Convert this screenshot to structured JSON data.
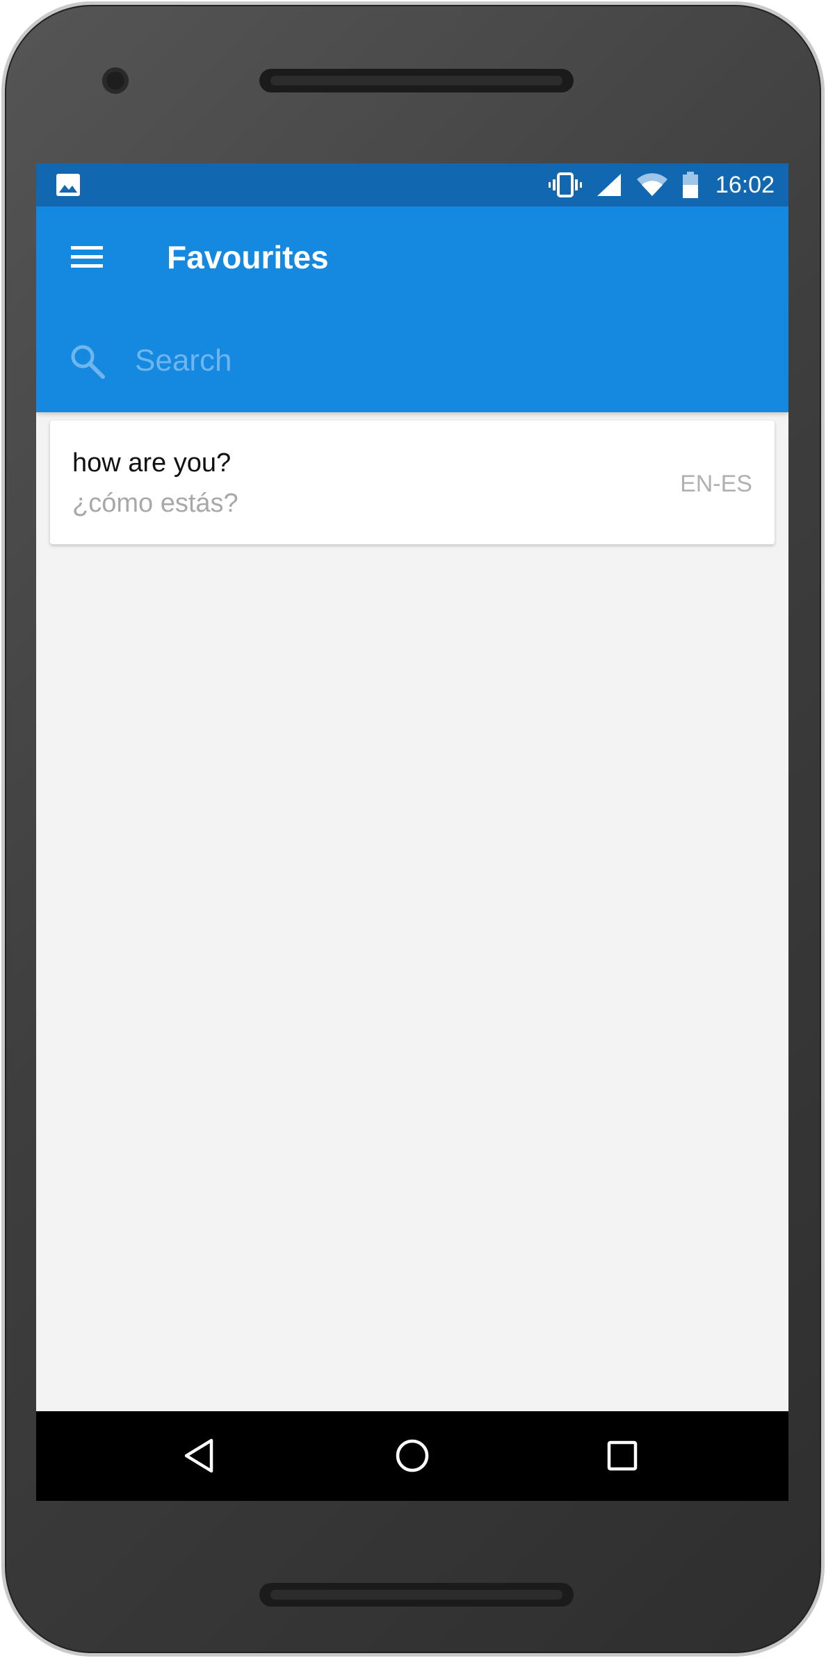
{
  "status_bar": {
    "left_icon": "image-notification-icon",
    "icons": [
      "vibrate-icon",
      "cell-signal-icon",
      "wifi-icon",
      "battery-icon"
    ],
    "time": "16:02"
  },
  "app_bar": {
    "menu_icon": "hamburger-menu-icon",
    "title": "Favourites",
    "search": {
      "icon": "search-icon",
      "placeholder": "Search",
      "value": ""
    }
  },
  "favourites": [
    {
      "source": "how are you?",
      "translation": "¿cómo estás?",
      "language_pair": "EN-ES"
    }
  ],
  "nav_bar": {
    "buttons": [
      "back-icon",
      "home-icon",
      "recents-icon"
    ]
  },
  "colors": {
    "status_bar": "#1268b0",
    "app_bar": "#1589e0",
    "background": "#f3f3f3",
    "card": "#ffffff",
    "secondary_text": "#a8a8a8"
  }
}
